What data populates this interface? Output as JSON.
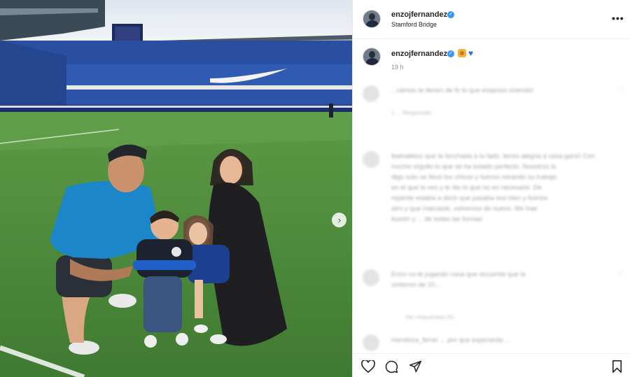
{
  "post": {
    "username": "enzojfernandez",
    "location": "Stamford Bridge",
    "time_ago": "19 h",
    "caption_emojis": [
      "lion-emoji",
      "blue-heart-emoji"
    ]
  },
  "comments": [
    {
      "username": "",
      "lines": [
        "...ciertos te llenen de fe lo que estamos vivendo!"
      ],
      "meta": "1 ... Responder",
      "replies": ""
    },
    {
      "username": "featvalieoz",
      "lines": [
        "featvalieoz que la hinchada a tu lado, tenes alegria a casa ganó! Con",
        "mucho orgullo lo que se ha estado perfecto. Nosotros lo",
        "digo solo se llevó los chicos y fuimos mirando su trabajo",
        "en el que lo ves y le dio lo que no es necesario. De",
        "repente estaba a decir que pasaba eso bien y fuimos",
        "otro y que marcaste, volvemos de nuevo. Me trae",
        "ilusión y ... de todas las formas"
      ],
      "meta": "",
      "replies": ""
    },
    {
      "username": "",
      "lines": [
        "Enzo no te jugando casa que recuerda que la",
        "sintieron de 10..."
      ],
      "meta": "",
      "replies": "Ver respuestas (6)"
    },
    {
      "username": "mendoza",
      "lines": [
        "mendoza_ferrer ...  por que esperando ..."
      ],
      "meta": "",
      "replies": ""
    }
  ],
  "actions": {
    "icons": [
      "heart-icon",
      "comment-icon",
      "share-icon",
      "bookmark-icon"
    ]
  },
  "colors": {
    "verified": "#3897f0",
    "jersey": "#1b86c8",
    "grass": "#4f8f3c",
    "stands": "#2a4fa0"
  }
}
